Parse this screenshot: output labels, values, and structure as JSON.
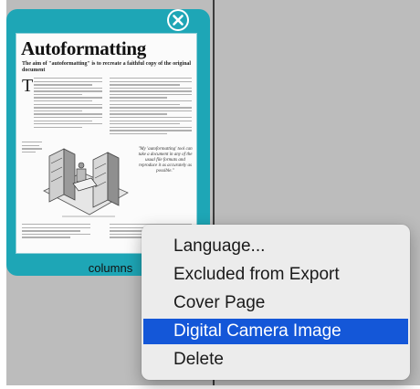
{
  "thumbnail": {
    "doc_title": "Autoformatting",
    "doc_subtitle": "The aim of \"autoformatting\" is to recreate a faithful copy of the original document",
    "dropcap": "T",
    "quote_text": "\"My 'autoformatting' tool can take a document in any of the usual file formats and reproduce it as accurately as possible.\"",
    "close_icon": "close-icon",
    "label": "columns"
  },
  "context_menu": {
    "items": [
      {
        "label": "Language...",
        "active": false
      },
      {
        "label": "Excluded from Export",
        "active": false
      },
      {
        "label": "Cover Page",
        "active": false
      },
      {
        "label": "Digital Camera Image",
        "active": true
      },
      {
        "label": "Delete",
        "active": false
      }
    ]
  },
  "colors": {
    "card": "#1ea6b6",
    "canvas": "#bcbcbc",
    "menu_background": "#ececec",
    "menu_highlight": "#1457d8"
  }
}
